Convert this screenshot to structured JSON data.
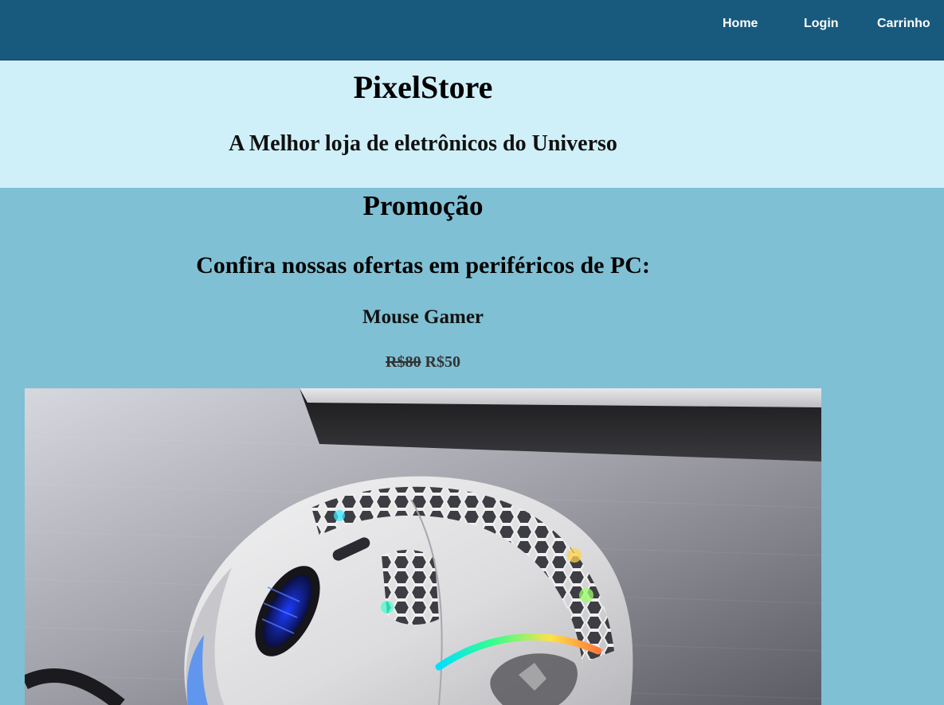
{
  "nav": {
    "home": "Home",
    "login": "Login",
    "cart": "Carrinho"
  },
  "header": {
    "title": "PixelStore",
    "tagline": "A Melhor loja de eletrônicos do Universo"
  },
  "promo": {
    "title": "Promoção",
    "subtitle": "Confira nossas ofertas em periféricos de PC:",
    "product": {
      "name": "Mouse Gamer",
      "old_price": "R$80",
      "new_price": "R$50"
    }
  },
  "colors": {
    "navbar": "#185a7e",
    "header_bg": "#d0f0f9",
    "promo_bg": "#7fc0d4"
  },
  "icons": {
    "product_image": "gaming-mouse-photo"
  }
}
